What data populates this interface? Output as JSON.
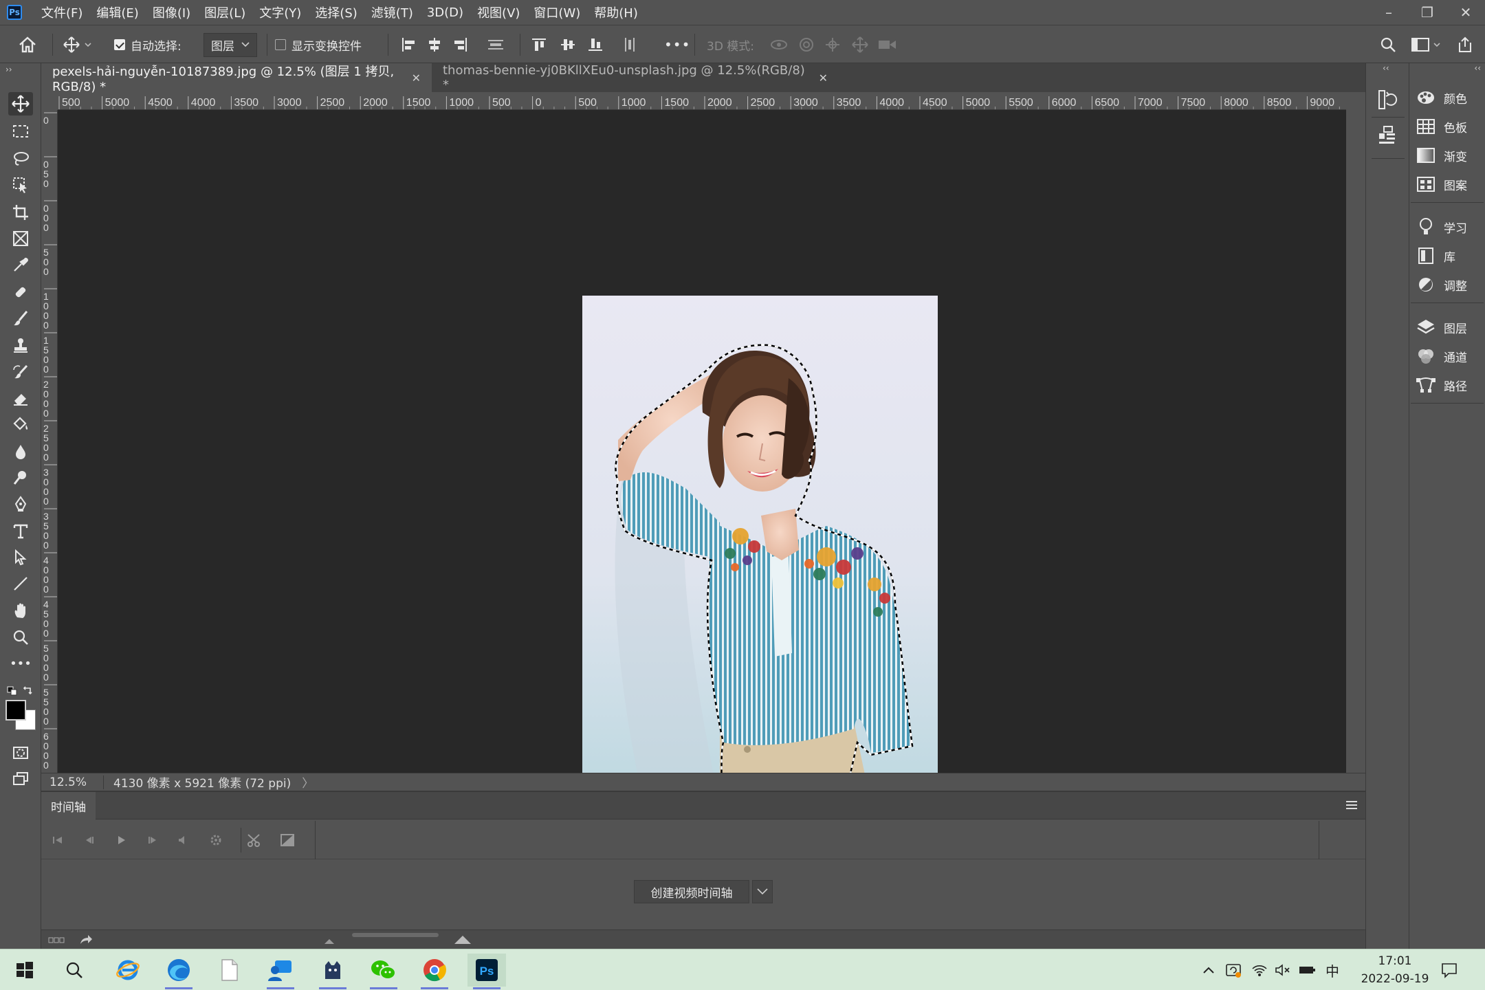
{
  "app": {
    "logo_text": "Ps"
  },
  "menu": [
    "文件(F)",
    "编辑(E)",
    "图像(I)",
    "图层(L)",
    "文字(Y)",
    "选择(S)",
    "滤镜(T)",
    "3D(D)",
    "视图(V)",
    "窗口(W)",
    "帮助(H)"
  ],
  "window_controls": {
    "minimize": "–",
    "restore": "❐",
    "close": "✕"
  },
  "options_bar": {
    "auto_select_label": "自动选择:",
    "auto_select_checked": true,
    "auto_select_target": "图层",
    "show_transform_label": "显示变换控件",
    "show_transform_checked": false,
    "more": "•••",
    "mode_3d_label": "3D 模式:"
  },
  "tabs": [
    {
      "label": "pexels-hải-nguyễn-10187389.jpg @ 12.5% (图层 1 拷贝, RGB/8) *",
      "active": true
    },
    {
      "label": "thomas-bennie-yj0BKllXEu0-unsplash.jpg @ 12.5%(RGB/8) *",
      "active": false
    }
  ],
  "ruler_h": [
    "500",
    "5000",
    "4500",
    "4000",
    "3500",
    "3000",
    "2500",
    "2000",
    "1500",
    "1000",
    "500",
    "0",
    "500",
    "1000",
    "1500",
    "2000",
    "2500",
    "3000",
    "3500",
    "4000",
    "4500",
    "5000",
    "5500",
    "6000",
    "6500",
    "7000",
    "7500",
    "8000",
    "8500",
    "9000"
  ],
  "ruler_v": [
    "0",
    "0 5 0",
    "0 0 0",
    "5 0 0",
    "1 0 0 0",
    "1 5 0 0",
    "2 0 0 0",
    "2 5 0 0",
    "3 0 0 0",
    "3 5 0 0",
    "4 0 0 0",
    "4 5 0 0",
    "5 0 0 0",
    "5 5 0 0",
    "6 0 0 0"
  ],
  "status": {
    "zoom": "12.5%",
    "doc_info": "4130 像素 x 5921 像素 (72 ppi)",
    "arrow": "〉"
  },
  "timeline": {
    "tab_label": "时间轴",
    "create_button": "创建视频时间轴"
  },
  "right_panels": {
    "group1": [
      {
        "label": "颜色",
        "icon": "palette-icon"
      },
      {
        "label": "色板",
        "icon": "swatches-icon"
      },
      {
        "label": "渐变",
        "icon": "gradient-icon"
      },
      {
        "label": "图案",
        "icon": "pattern-icon"
      }
    ],
    "group2": [
      {
        "label": "学习",
        "icon": "learn-icon"
      },
      {
        "label": "库",
        "icon": "library-icon"
      },
      {
        "label": "调整",
        "icon": "adjust-icon"
      }
    ],
    "group3": [
      {
        "label": "图层",
        "icon": "layers-icon"
      },
      {
        "label": "通道",
        "icon": "channels-icon"
      },
      {
        "label": "路径",
        "icon": "paths-icon"
      }
    ]
  },
  "taskbar": {
    "time": "17:01",
    "date": "2022-09-19",
    "ime": "中",
    "apps": [
      "windows-start-icon",
      "search-icon",
      "ie-icon",
      "edge-icon",
      "file-icon",
      "teams-chat-icon",
      "cat-app-icon",
      "wechat-icon",
      "chrome-icon",
      "photoshop-icon"
    ]
  },
  "colors": {
    "ui_bg": "#535353",
    "canvas_bg": "#282828",
    "taskbar_bg": "#d6ead9",
    "accent": "#2e8cf0"
  }
}
